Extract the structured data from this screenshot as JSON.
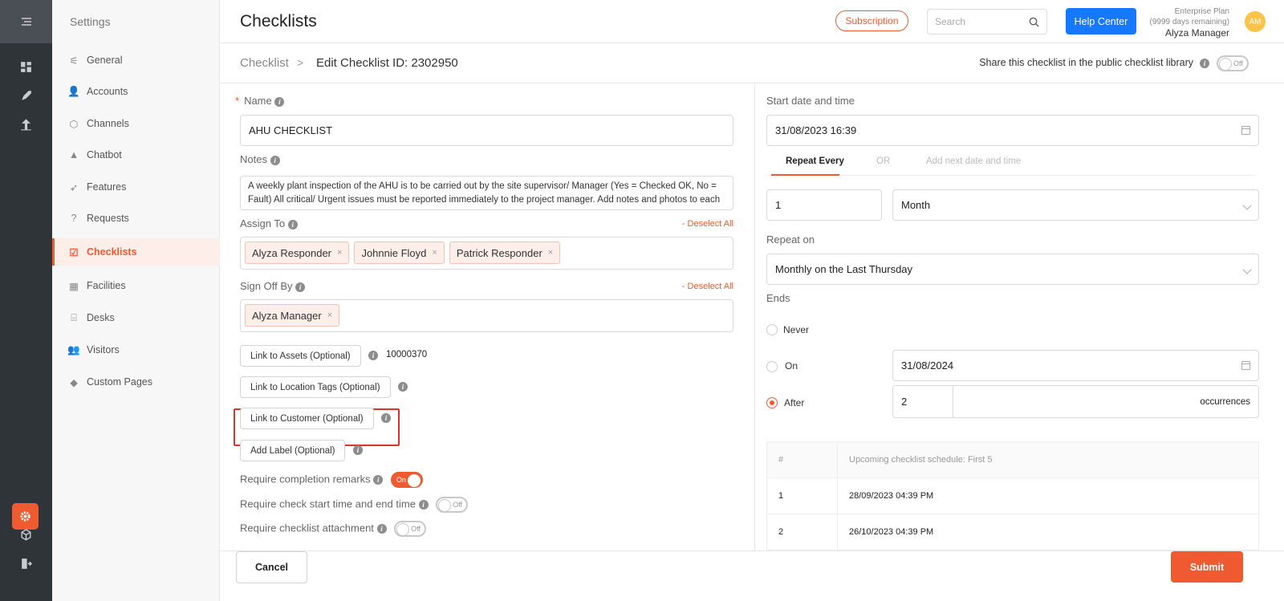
{
  "rail": {
    "icons": [
      "menu-icon",
      "dashboard-icon",
      "rocket-icon",
      "analytics-icon",
      "settings-icon",
      "cube-icon",
      "logout-icon"
    ]
  },
  "sidebar": {
    "title": "Settings",
    "items": [
      {
        "label": "General",
        "icon": "sliders-icon"
      },
      {
        "label": "Accounts",
        "icon": "users-icon"
      },
      {
        "label": "Channels",
        "icon": "box-icon"
      },
      {
        "label": "Chatbot",
        "icon": "chat-icon"
      },
      {
        "label": "Features",
        "icon": "rocket-icon"
      },
      {
        "label": "Requests",
        "icon": "question-icon"
      },
      {
        "label": "Checklists",
        "icon": "checklist-icon",
        "active": true
      },
      {
        "label": "Facilities",
        "icon": "calendar-icon"
      },
      {
        "label": "Desks",
        "icon": "desk-icon"
      },
      {
        "label": "Visitors",
        "icon": "visitors-icon"
      },
      {
        "label": "Custom Pages",
        "icon": "paint-icon"
      }
    ]
  },
  "header": {
    "title": "Checklists",
    "subscription_label": "Subscription",
    "search_placeholder": "Search",
    "help_label": "Help Center",
    "plan_name": "Enterprise Plan",
    "plan_remaining": "(9999 days remaining)",
    "user_name": "Alyza Manager",
    "avatar_initials": "AM",
    "accent": "#f05a30",
    "help_color": "#1677ff"
  },
  "breadcrumb": {
    "parent": "Checklist",
    "separator": ">",
    "current": "Edit Checklist ID: 2302950",
    "share_label": "Share this checklist in the public checklist library",
    "share_toggle": "Off"
  },
  "form": {
    "name_label": "Name",
    "name_value": "AHU CHECKLIST",
    "notes_label": "Notes",
    "notes_value": "A weekly plant inspection of the AHU is to be carried out by the site supervisor/ Manager (Yes = Checked OK, No = Fault) All critical/ Urgent issues must be reported immediately to the project manager. Add notes and photos to each",
    "assign_label": "Assign To",
    "deselect_label": "- Deselect All",
    "assignees": [
      "Alyza Responder",
      "Johnnie Floyd",
      "Patrick Responder"
    ],
    "signoff_label": "Sign Off By",
    "signoff": [
      "Alyza Manager"
    ],
    "tag_remove": "×",
    "link_assets": "Link to Assets (Optional)",
    "asset_value": "10000370",
    "link_location": "Link to Location Tags (Optional)",
    "link_customer": "Link to Customer (Optional)",
    "add_label": "Add Label (Optional)",
    "completion_remarks": "Require completion remarks",
    "completion_toggle": "On",
    "check_time": "Require check start time and end time",
    "check_time_toggle": "Off",
    "attachment": "Require checklist attachment",
    "attachment_toggle": "Off"
  },
  "schedule": {
    "start_label": "Start date and time",
    "start_value": "31/08/2023 16:39",
    "tabs": [
      "Repeat Every",
      "OR",
      "Add next date and time"
    ],
    "repeat_count": "1",
    "repeat_unit": "Month",
    "repeat_on_label": "Repeat on",
    "repeat_on_value": "Monthly on the Last Thursday",
    "ends_label": "Ends",
    "never_label": "Never",
    "on_label": "On",
    "on_date": "31/08/2024",
    "after_label": "After",
    "after_count": "2",
    "occurrences_label": "occurrences",
    "table_head": [
      "#",
      "Upcoming checklist schedule: First 5"
    ],
    "rows": [
      {
        "n": "1",
        "date": "28/09/2023 04:39 PM"
      },
      {
        "n": "2",
        "date": "26/10/2023 04:39 PM"
      }
    ]
  },
  "footer": {
    "cancel_label": "Cancel",
    "submit_label": "Submit"
  }
}
